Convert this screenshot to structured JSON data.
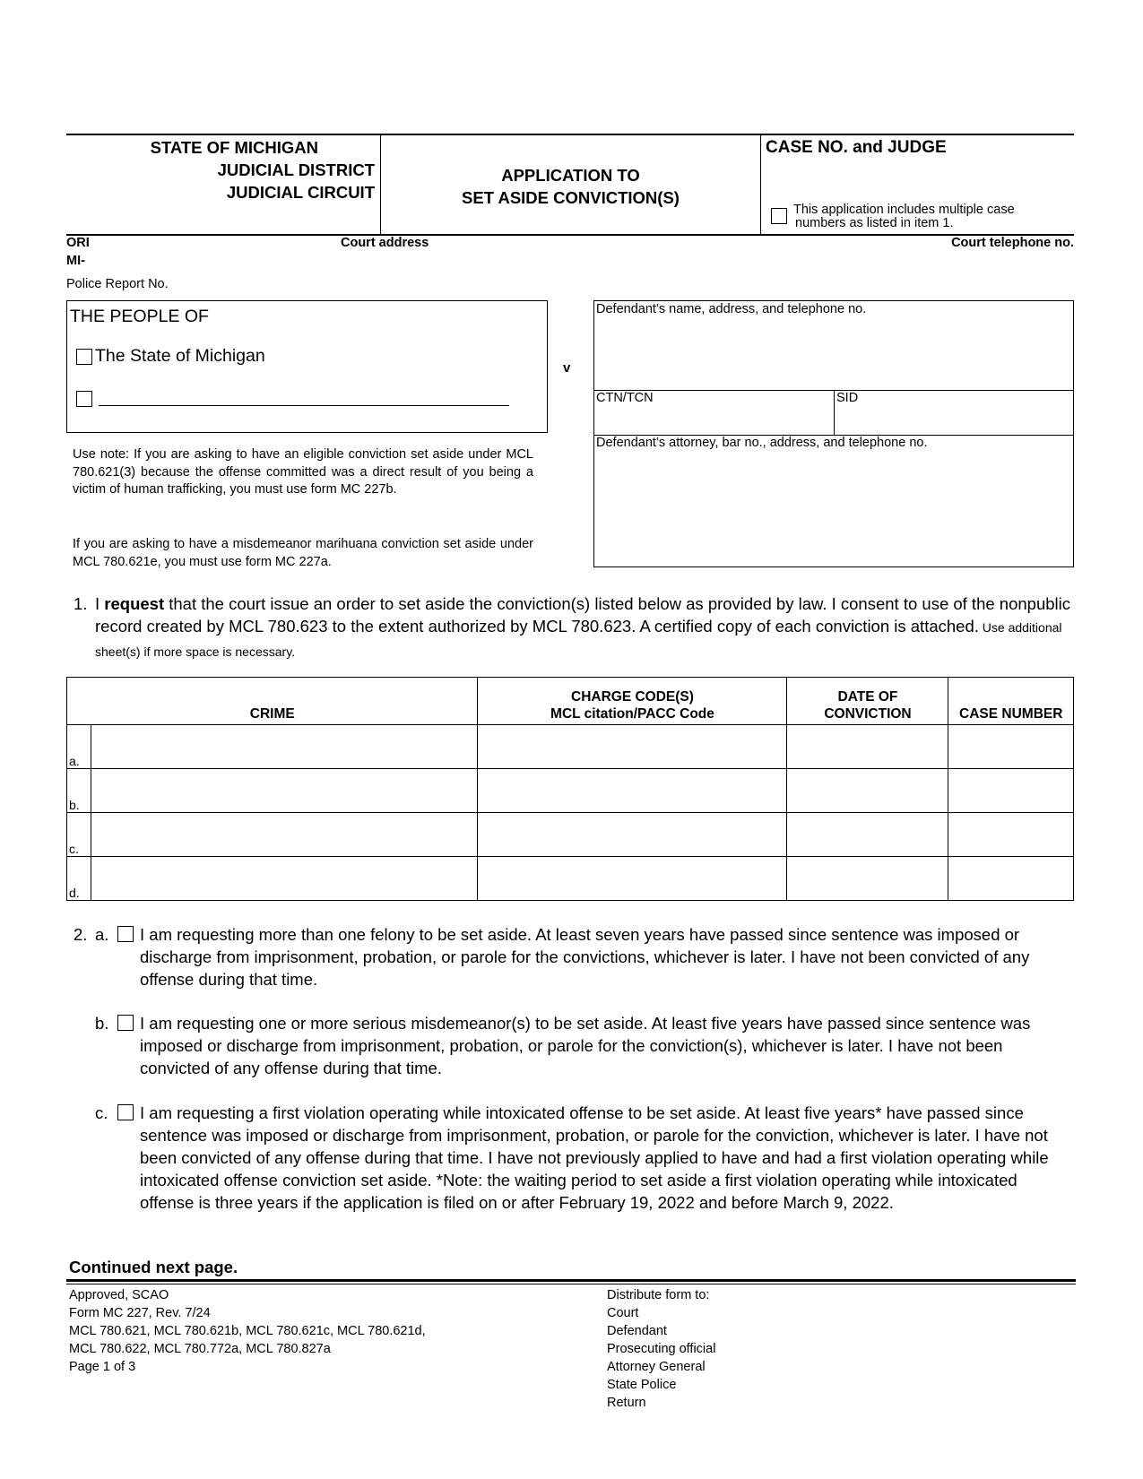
{
  "header": {
    "state": "STATE OF MICHIGAN",
    "district": "JUDICIAL DISTRICT",
    "circuit": "JUDICIAL CIRCUIT",
    "title_line1": "APPLICATION TO",
    "title_line2": "SET ASIDE CONVICTION(S)",
    "case_label": "CASE NO. and JUDGE",
    "multiple_cases_line1": "This application includes multiple case",
    "multiple_cases_line2": "numbers as listed in item 1."
  },
  "info_row": {
    "ori_label": "ORI",
    "ori_value": "MI-",
    "court_address_label": "Court address",
    "court_telephone_label": "Court telephone no.",
    "police_report_label": "Police Report No."
  },
  "plaintiff": {
    "people_of": "THE PEOPLE OF",
    "state_option": "The State of Michigan",
    "other_option": ""
  },
  "versus": "v",
  "defendant": {
    "name_label": "Defendant’s name, address, and telephone no.",
    "ctn_label": "CTN/TCN",
    "sid_label": "SID",
    "attorney_label": "Defendant’s attorney, bar no., address, and telephone no."
  },
  "use_note": {
    "para1": "Use note:  If you are asking to have an eligible conviction set aside under MCL 780.621(3) because the offense committed was a direct result of you being a victim of human trafficking, you must use form MC 227b.",
    "para2": "If you are asking to have a misdemeanor marihuana conviction set aside under MCL 780.621e, you must use form MC 227a."
  },
  "item1": {
    "number": "1.",
    "pre": "I ",
    "bold": "request",
    "text": " that the court issue an order to set aside the conviction(s) listed below as provided by law. I consent to use of the nonpublic record created by MCL 780.623 to the extent authorized by MCL 780.623.  A certified copy of each conviction is attached.",
    "small": " Use additional sheet(s) if more space is necessary."
  },
  "table": {
    "headers": {
      "crime": "CRIME",
      "charge_line1": "CHARGE CODE(S)",
      "charge_line2": "MCL citation/PACC Code",
      "date_line1": "DATE OF",
      "date_line2": "CONVICTION",
      "case": "CASE NUMBER"
    },
    "rows": [
      {
        "letter": "a.",
        "crime": "",
        "charge": "",
        "date": "",
        "case": ""
      },
      {
        "letter": "b.",
        "crime": "",
        "charge": "",
        "date": "",
        "case": ""
      },
      {
        "letter": "c.",
        "crime": "",
        "charge": "",
        "date": "",
        "case": ""
      },
      {
        "letter": "d.",
        "crime": "",
        "charge": "",
        "date": "",
        "case": ""
      }
    ]
  },
  "item2": {
    "number": "2.",
    "a": {
      "letter": "a.",
      "text": "I am requesting more than one felony to be set aside. At least seven years have passed since sentence was imposed or discharge from imprisonment, probation, or parole for the convictions, whichever is later. I have not been convicted of any offense during that time."
    },
    "b": {
      "letter": "b.",
      "text": "I am requesting one or more serious misdemeanor(s) to be set aside. At least five years have passed since sentence was imposed or discharge from imprisonment, probation, or parole for the conviction(s), whichever is later. I have not been convicted of any offense during that time."
    },
    "c": {
      "letter": "c.",
      "text": "I am requesting a first violation operating while intoxicated offense to be set aside. At least five years* have passed since sentence was imposed or discharge from imprisonment, probation, or parole for the conviction, whichever is later. I have not been convicted of any offense during that time. I have not previously applied to have and had a first violation operating while intoxicated offense conviction set aside. *Note:  the waiting period to set aside a first violation operating while intoxicated offense is three years if the application is filed on or after February 19, 2022 and before March 9, 2022."
    }
  },
  "continued": "Continued next page.",
  "footer": {
    "left": [
      "Approved, SCAO",
      "Form MC 227, Rev. 7/24",
      "MCL 780.621, MCL 780.621b, MCL 780.621c, MCL 780.621d,",
      "MCL 780.622, MCL 780.772a, MCL 780.827a",
      "Page 1 of 3"
    ],
    "distribute_label": "Distribute form to:",
    "distribute": [
      "Court",
      "Defendant",
      "Prosecuting official",
      "Attorney General",
      "State Police",
      "Return"
    ]
  }
}
